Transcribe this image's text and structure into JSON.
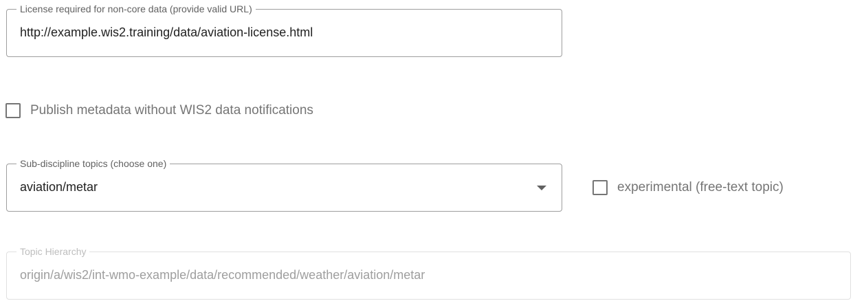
{
  "license": {
    "label": "License required for non-core data (provide valid URL)",
    "value": "http://example.wis2.training/data/aviation-license.html"
  },
  "publish_checkbox": {
    "label": "Publish metadata without WIS2 data notifications",
    "checked": false
  },
  "subdiscipline": {
    "label": "Sub-discipline topics (choose one)",
    "selected": "aviation/metar",
    "arrow_icon": "caret-down-icon"
  },
  "experimental_checkbox": {
    "label": "experimental (free-text topic)",
    "checked": false
  },
  "topic_hierarchy": {
    "label": "Topic Hierarchy",
    "value": "origin/a/wis2/int-wmo-example/data/recommended/weather/aviation/metar",
    "disabled": true
  },
  "colors": {
    "border": "#9e9e9e",
    "border_disabled": "#e0e0e0",
    "text": "#212121",
    "label_text": "#616161",
    "checkbox_label": "#757575",
    "disabled_text": "#9e9e9e"
  }
}
